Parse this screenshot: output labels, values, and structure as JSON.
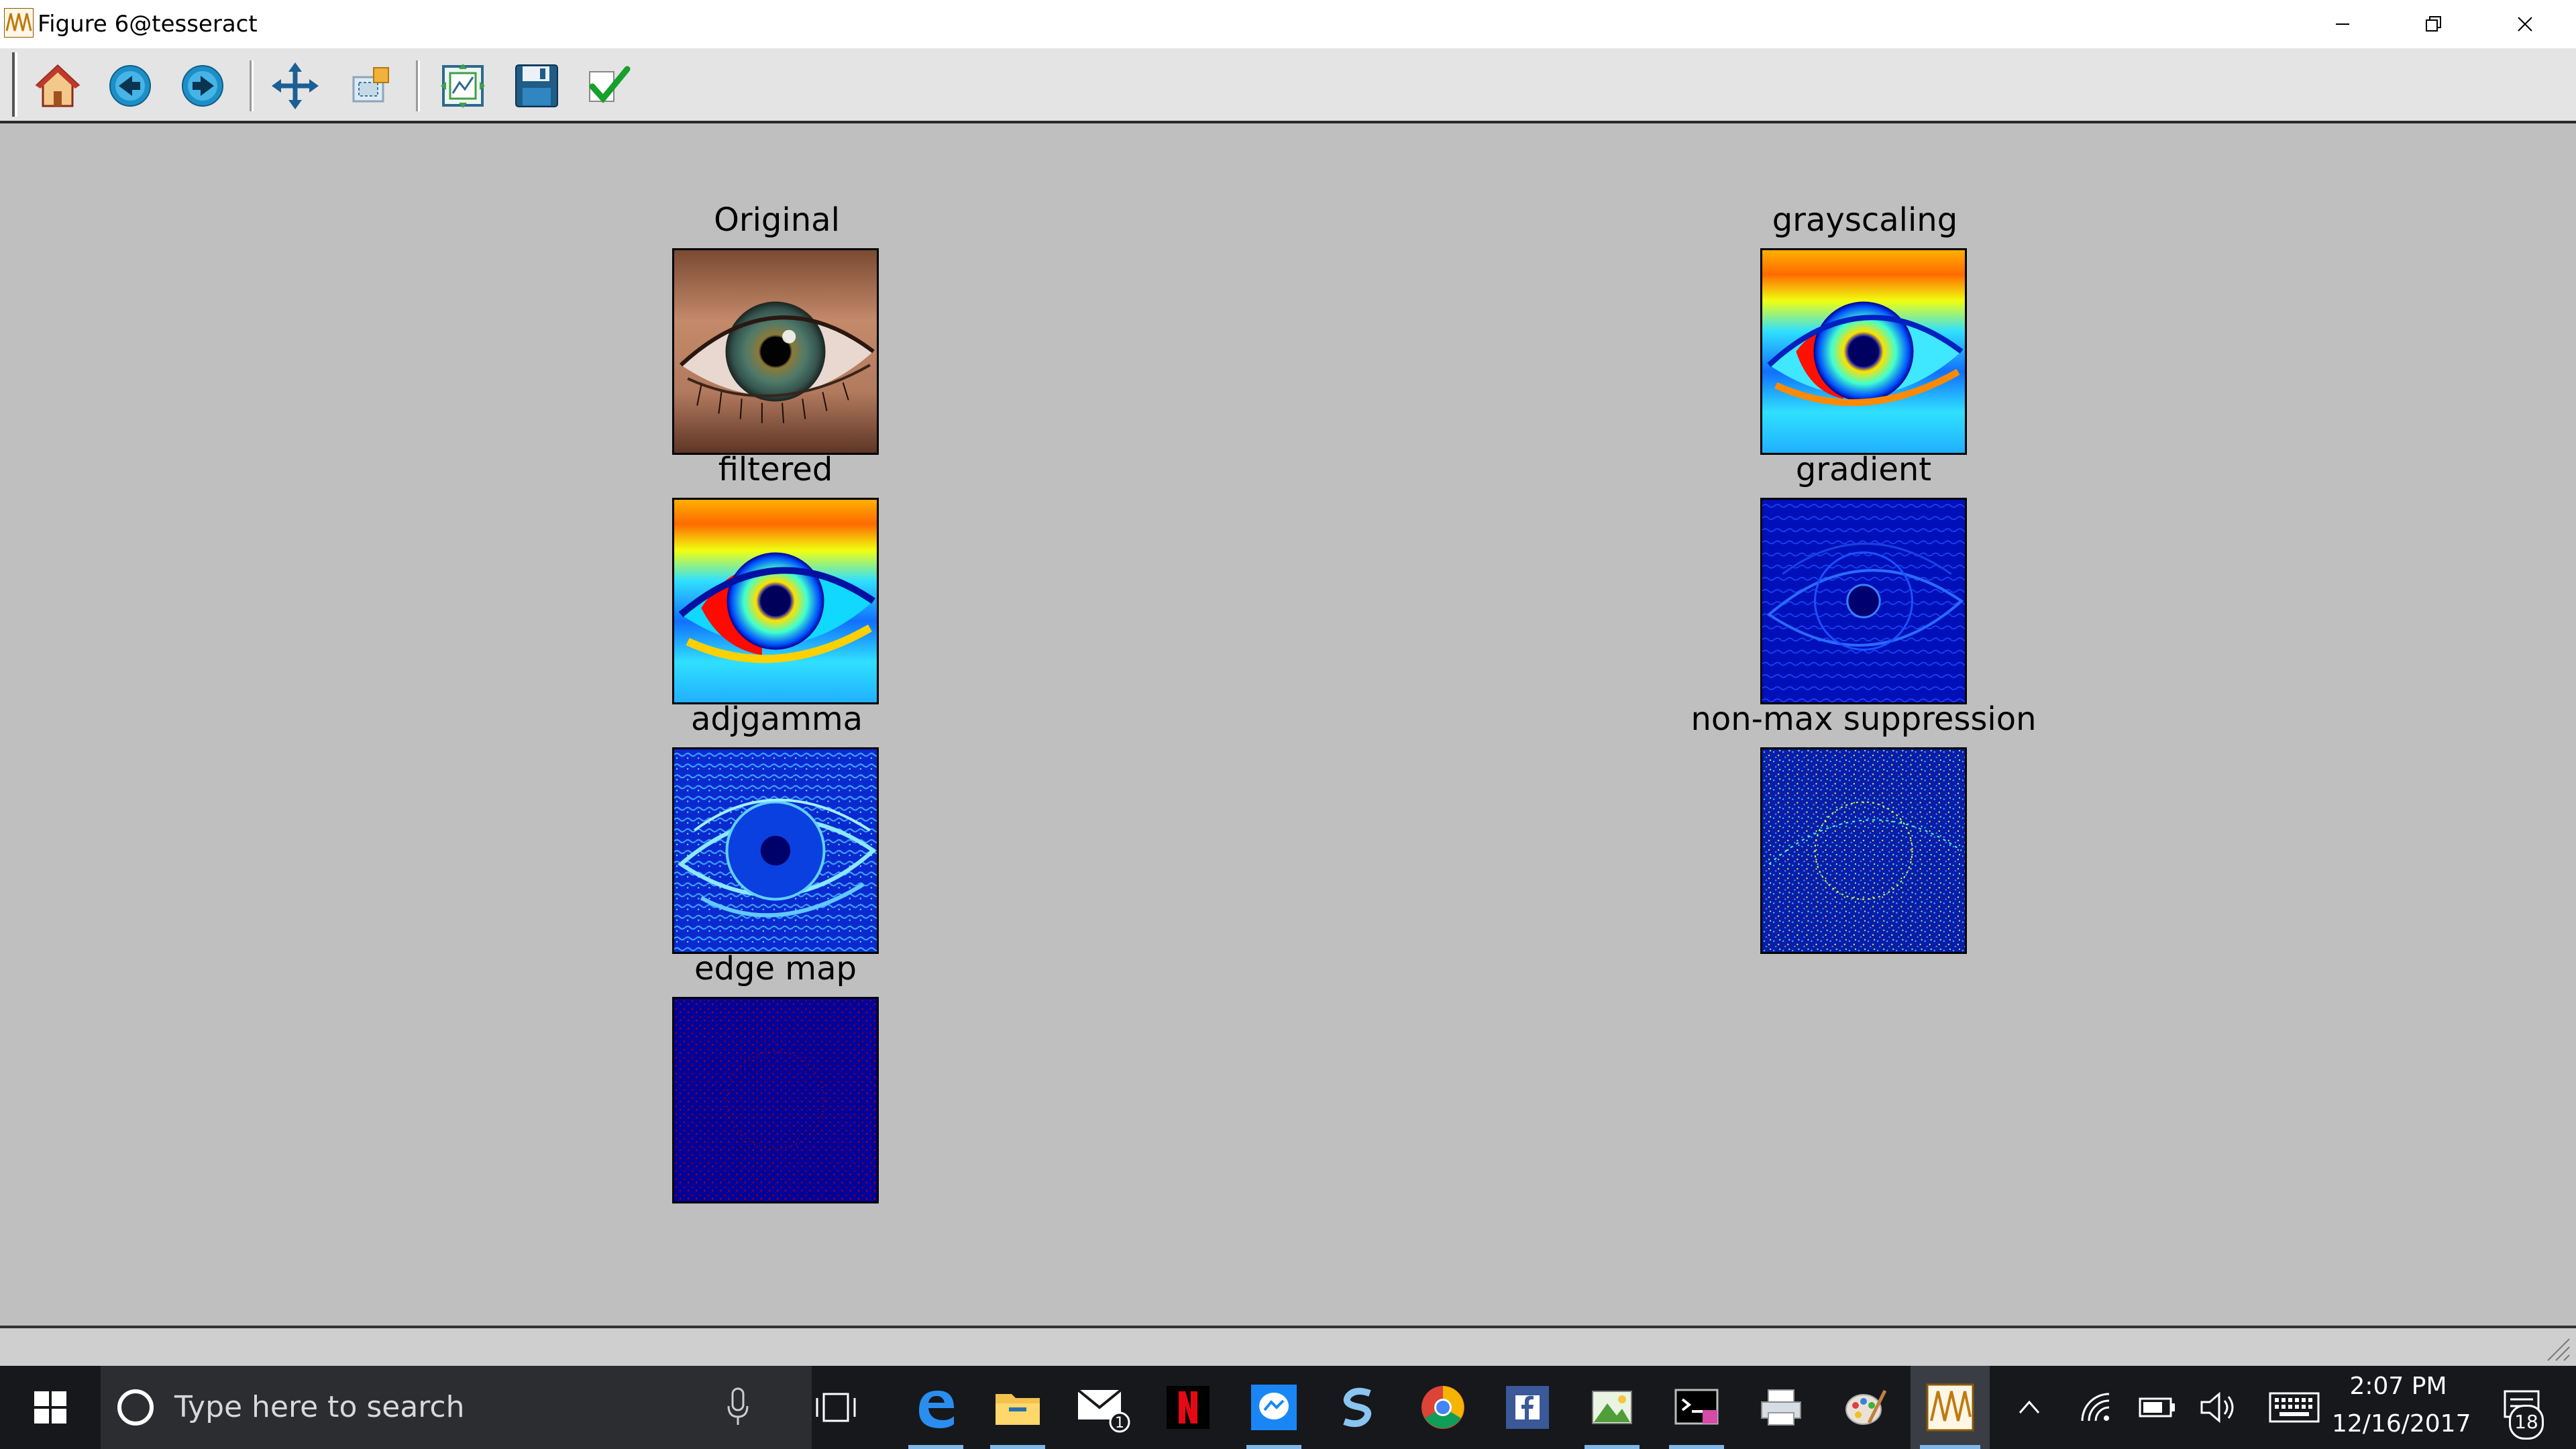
{
  "window": {
    "title": "Figure 6@tesseract",
    "app_icon": "matplotlib-figure-icon",
    "controls": [
      "minimize-icon",
      "restore-icon",
      "close-icon"
    ]
  },
  "toolbar": {
    "buttons": [
      {
        "name": "home",
        "icon": "home-icon"
      },
      {
        "name": "back",
        "icon": "arrow-left-icon"
      },
      {
        "name": "forward",
        "icon": "arrow-right-icon"
      },
      {
        "name": "pan",
        "icon": "move-arrows-icon"
      },
      {
        "name": "zoom",
        "icon": "zoom-rect-icon"
      },
      {
        "name": "subplots",
        "icon": "configure-subplots-icon"
      },
      {
        "name": "save",
        "icon": "floppy-disk-icon"
      },
      {
        "name": "customize",
        "icon": "checkmark-icon"
      }
    ]
  },
  "figure": {
    "panels": [
      {
        "title": "Original",
        "image": "eye-photo"
      },
      {
        "title": "grayscaling",
        "image": "eye-jet-colormap"
      },
      {
        "title": "filtered",
        "image": "eye-jet-colormap-filtered"
      },
      {
        "title": "gradient",
        "image": "eye-gradient-blue"
      },
      {
        "title": "adjgamma",
        "image": "eye-gamma-blue"
      },
      {
        "title": "non-max suppression",
        "image": "eye-nms-blue-speckle"
      },
      {
        "title": "edge map",
        "image": "eye-edge-map-dark"
      }
    ]
  },
  "statusbar": {
    "text": ""
  },
  "taskbar": {
    "search_placeholder": "Type here to search",
    "apps": [
      "task-view-icon",
      "edge-icon",
      "file-explorer-icon",
      "mail-icon",
      "netflix-icon",
      "messenger-icon",
      "s-app-icon",
      "chrome-icon",
      "facebook-icon",
      "photos-icon",
      "terminal-icon",
      "printer-icon",
      "paint-icon",
      "matplotlib-figure-icon"
    ],
    "mail_badge": "1",
    "clock_time": "2:07 PM",
    "clock_date": "12/16/2017",
    "notification_count": "18"
  },
  "colors": {
    "canvas_bg": "#bfbfbf",
    "toolbar_bg": "#e4e4e4",
    "taskbar_bg": "#16181c",
    "jet_dark": "#00008b",
    "jet_red": "#ff0000"
  }
}
